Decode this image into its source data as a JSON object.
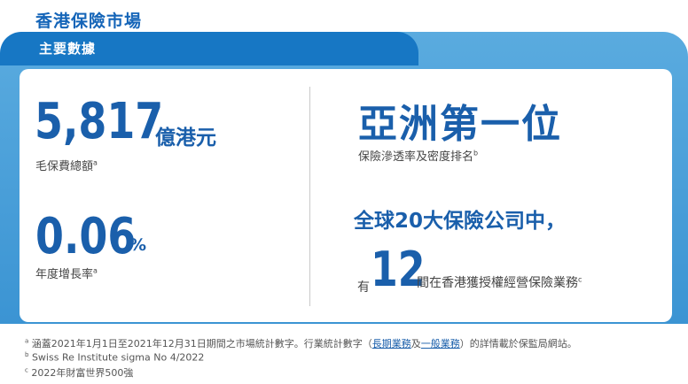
{
  "header": {
    "title": "香港保險市場",
    "tab_label": "主要數據"
  },
  "stats": {
    "gross_premium": {
      "value": "5,817",
      "unit": "億港元",
      "label": "毛保費總額",
      "note": "a"
    },
    "growth": {
      "value": "0.06",
      "unit": "%",
      "label": "年度增長率",
      "note": "a"
    }
  },
  "ranking": {
    "rank": "亞洲第一位",
    "label": "保險滲透率及密度排名",
    "note": "b",
    "global_heading": "全球20大保險公司中，",
    "prefix": "有",
    "count": "12",
    "suffix": "間在香港獲授權經營保險業務",
    "count_note": "c"
  },
  "footnotes": {
    "a": {
      "marker": "a",
      "text_before": "涵蓋2021年1月1日至2021年12月31日期間之市場統計數字。行業統計數字（",
      "link1": "長期業務",
      "text_mid": "及",
      "link2": "一般業務",
      "text_after": "）的詳情載於保監局網站。"
    },
    "b": {
      "marker": "b",
      "text": "Swiss Re Institute sigma No 4/2022"
    },
    "c": {
      "marker": "c",
      "text": "2022年財富世界500強"
    }
  }
}
